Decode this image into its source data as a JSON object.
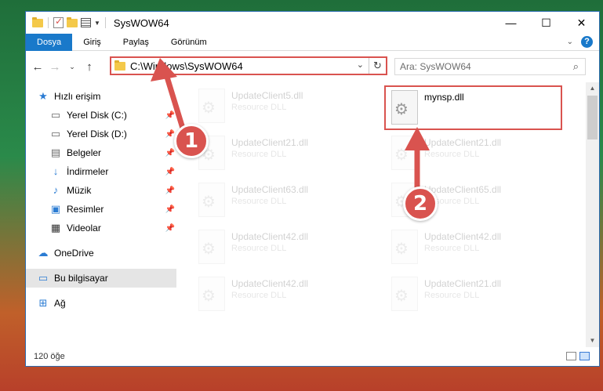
{
  "window": {
    "title": "SysWOW64",
    "controls": {
      "minimize": "—",
      "maximize": "☐",
      "close": "✕"
    }
  },
  "ribbon": {
    "tabs": [
      "Dosya",
      "Giriş",
      "Paylaş",
      "Görünüm"
    ],
    "active_tab": "Dosya",
    "help": "?"
  },
  "nav": {
    "address": "C:\\Windows\\SysWOW64",
    "search_placeholder": "Ara: SysWOW64"
  },
  "sidebar": {
    "quick_access": "Hızlı erişim",
    "items": [
      {
        "label": "Yerel Disk (C:)",
        "icon": "drive-icon",
        "pinned": true
      },
      {
        "label": "Yerel Disk (D:)",
        "icon": "drive-icon",
        "pinned": true
      },
      {
        "label": "Belgeler",
        "icon": "documents-icon",
        "pinned": true
      },
      {
        "label": "İndirmeler",
        "icon": "downloads-icon",
        "pinned": true
      },
      {
        "label": "Müzik",
        "icon": "music-icon",
        "pinned": true
      },
      {
        "label": "Resimler",
        "icon": "pictures-icon",
        "pinned": true
      },
      {
        "label": "Videolar",
        "icon": "videos-icon",
        "pinned": true
      }
    ],
    "onedrive": "OneDrive",
    "this_pc": "Bu bilgisayar",
    "network": "Ağ"
  },
  "files": {
    "left_column": [
      {
        "name": "UpdateClient5.dll",
        "type": "Resource DLL"
      },
      {
        "name": "UpdateClient21.dll",
        "type": "Resource DLL"
      },
      {
        "name": "UpdateClient63.dll",
        "type": "Resource DLL"
      },
      {
        "name": "UpdateClient42.dll",
        "type": "Resource DLL"
      },
      {
        "name": "UpdateClient42.dll",
        "type": "Resource DLL"
      }
    ],
    "right_column": [
      {
        "name": "mynsp.dll",
        "type": ""
      },
      {
        "name": "UpdateClient21.dll",
        "type": "Resource DLL"
      },
      {
        "name": "UpdateClient65.dll",
        "type": "Resource DLL"
      },
      {
        "name": "UpdateClient42.dll",
        "type": "Resource DLL"
      },
      {
        "name": "UpdateClient21.dll",
        "type": "Resource DLL"
      }
    ]
  },
  "status": {
    "count": "120 öğe"
  },
  "annotations": {
    "badge1": "1",
    "badge2": "2"
  },
  "colors": {
    "accent": "#1979ca",
    "annotation": "#d9534f"
  }
}
